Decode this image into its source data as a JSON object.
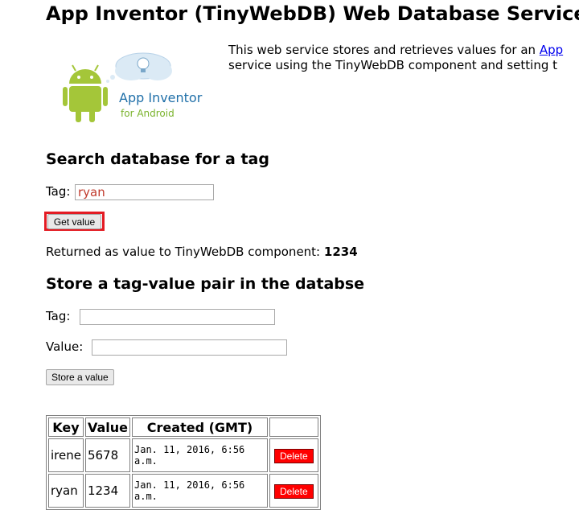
{
  "header": {
    "title": "App Inventor (TinyWebDB) Web Database Service"
  },
  "intro": {
    "line1_text": "This web service stores and retrieves values for an ",
    "line1_link": "App",
    "line2_text": "service using the TinyWebDB component and setting t"
  },
  "logo": {
    "title": "App Inventor",
    "subtitle": "for Android",
    "colors": {
      "android_green": "#a4c639",
      "cloud": "#dbeaf5",
      "text_blue": "#1f6fa8"
    }
  },
  "search": {
    "heading": "Search database for a tag",
    "tag_label": "Tag:",
    "tag_value": "ryan",
    "get_button": "Get value",
    "returned_label": "Returned as value to TinyWebDB component:",
    "returned_value": "1234"
  },
  "store": {
    "heading": "Store a tag-value pair in the databse",
    "tag_label": "Tag:",
    "tag_value": "",
    "value_label": "Value:",
    "value_value": "",
    "store_button": "Store a value"
  },
  "table": {
    "headers": [
      "Key",
      "Value",
      "Created (GMT)",
      ""
    ],
    "rows": [
      {
        "key": "irene",
        "value": "5678",
        "created": "Jan. 11, 2016, 6:56 a.m.",
        "action": "Delete"
      },
      {
        "key": "ryan",
        "value": "1234",
        "created": "Jan. 11, 2016, 6:56 a.m.",
        "action": "Delete"
      }
    ]
  },
  "colors": {
    "highlight": "#e31b23",
    "delete_button": "#ff0000",
    "link": "#0000ee"
  }
}
